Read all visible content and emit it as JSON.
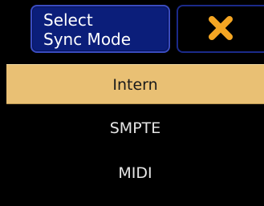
{
  "dialog": {
    "title": "Select\nSync Mode",
    "close_icon": "close-x-icon",
    "accent_color": "#f5a623",
    "title_bg_color": "#0b1e7a",
    "selected_bg_color": "#e9c074"
  },
  "options": [
    {
      "label": "Intern",
      "selected": true
    },
    {
      "label": "SMPTE",
      "selected": false
    },
    {
      "label": "MIDI",
      "selected": false
    }
  ]
}
